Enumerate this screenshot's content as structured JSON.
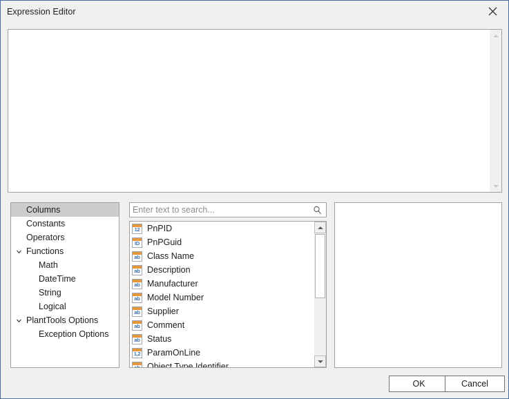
{
  "window": {
    "title": "Expression Editor",
    "close_icon": "close-icon"
  },
  "editor": {
    "value": "",
    "scrollbar": {
      "up_icon": "triangle-up-icon",
      "down_icon": "triangle-down-icon"
    }
  },
  "tree": {
    "items": [
      {
        "label": "Columns",
        "level": 0,
        "selected": true,
        "expander": ""
      },
      {
        "label": "Constants",
        "level": 0,
        "selected": false,
        "expander": ""
      },
      {
        "label": "Operators",
        "level": 0,
        "selected": false,
        "expander": ""
      },
      {
        "label": "Functions",
        "level": 0,
        "selected": false,
        "expander": "chevron-down-icon"
      },
      {
        "label": "Math",
        "level": 1,
        "selected": false,
        "expander": ""
      },
      {
        "label": "DateTime",
        "level": 1,
        "selected": false,
        "expander": ""
      },
      {
        "label": "String",
        "level": 1,
        "selected": false,
        "expander": ""
      },
      {
        "label": "Logical",
        "level": 1,
        "selected": false,
        "expander": ""
      },
      {
        "label": "PlantTools Options",
        "level": 0,
        "selected": false,
        "expander": "chevron-down-icon"
      },
      {
        "label": "Exception Options",
        "level": 1,
        "selected": false,
        "expander": ""
      }
    ]
  },
  "search": {
    "value": "",
    "placeholder": "Enter text to search...",
    "icon": "search-icon"
  },
  "list": {
    "items": [
      {
        "label": "PnPID",
        "type": "12"
      },
      {
        "label": "PnPGuid",
        "type": "ID"
      },
      {
        "label": "Class Name",
        "type": "ab"
      },
      {
        "label": "Description",
        "type": "ab"
      },
      {
        "label": "Manufacturer",
        "type": "ab"
      },
      {
        "label": "Model Number",
        "type": "ab"
      },
      {
        "label": "Supplier",
        "type": "ab"
      },
      {
        "label": "Comment",
        "type": "ab"
      },
      {
        "label": "Status",
        "type": "ab"
      },
      {
        "label": "ParamOnLine",
        "type": "1,2"
      },
      {
        "label": "Object Type Identifier",
        "type": "ab"
      }
    ],
    "scrollbar": {
      "up_icon": "triangle-up-icon",
      "down_icon": "triangle-down-icon"
    }
  },
  "footer": {
    "ok_label": "OK",
    "cancel_label": "Cancel"
  },
  "colors": {
    "window_border": "#4a6c9b",
    "chrome": "#f0f0f0",
    "selection": "#cdcdcd",
    "icon_accent": "#e8963c",
    "icon_text": "#3b6fb0",
    "placeholder": "#8c8c8c"
  }
}
